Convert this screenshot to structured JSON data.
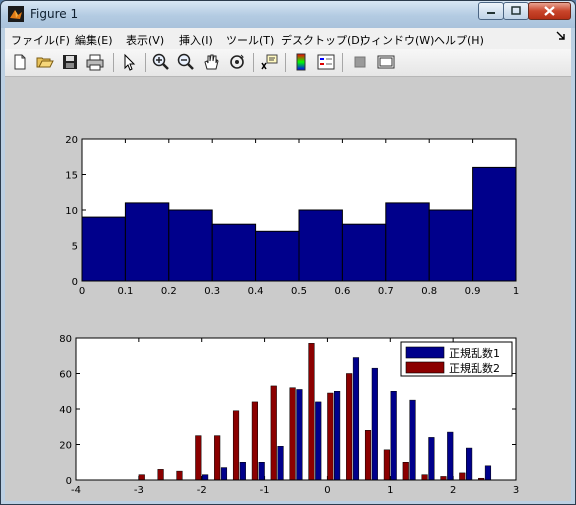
{
  "window": {
    "title": "Figure 1"
  },
  "menu": [
    {
      "label": "ファイル(F)"
    },
    {
      "label": "編集(E)"
    },
    {
      "label": "表示(V)"
    },
    {
      "label": "挿入(I)"
    },
    {
      "label": "ツール(T)"
    },
    {
      "label": "デスクトップ(D)"
    },
    {
      "label": "ウィンドウ(W)"
    },
    {
      "label": "ヘルプ(H)"
    }
  ],
  "toolbar": [
    "new-figure-icon",
    "open-icon",
    "save-icon",
    "print-icon",
    "pointer-icon",
    "zoom-in-icon",
    "zoom-out-icon",
    "pan-hand-icon",
    "rotate-3d-icon",
    "data-cursor-icon",
    "colorbar-icon",
    "legend-icon",
    "hide-plot-tools-icon",
    "show-plot-tools-icon"
  ],
  "chart_data": [
    {
      "type": "bar",
      "x": [
        0.05,
        0.15,
        0.25,
        0.35,
        0.45,
        0.55,
        0.65,
        0.75,
        0.85,
        0.95
      ],
      "values": [
        9,
        11,
        10,
        8,
        7,
        10,
        8,
        11,
        10,
        16
      ],
      "xlim": [
        0,
        1
      ],
      "ylim": [
        0,
        20
      ],
      "xticks": [
        "0",
        "0.1",
        "0.2",
        "0.3",
        "0.4",
        "0.5",
        "0.6",
        "0.7",
        "0.8",
        "0.9",
        "1"
      ],
      "yticks": [
        "0",
        "5",
        "10",
        "15",
        "20"
      ],
      "color": "#00008b"
    },
    {
      "type": "bar",
      "x": [
        -2.9,
        -2.6,
        -2.3,
        -2.0,
        -1.7,
        -1.4,
        -1.1,
        -0.8,
        -0.5,
        -0.2,
        0.1,
        0.4,
        0.7,
        1.0,
        1.3,
        1.6,
        1.9,
        2.2,
        2.5
      ],
      "xlim": [
        -4,
        3
      ],
      "ylim": [
        0,
        80
      ],
      "xticks": [
        "-4",
        "-3",
        "-2",
        "-1",
        "0",
        "1",
        "2",
        "3"
      ],
      "yticks": [
        "0",
        "20",
        "40",
        "60",
        "80"
      ],
      "legend_position": "top-right",
      "series": [
        {
          "name": "正規乱数1",
          "color": "#00008b",
          "values": [
            0,
            0,
            0,
            3,
            7,
            10,
            10,
            19,
            51,
            44,
            50,
            69,
            63,
            50,
            45,
            24,
            27,
            18,
            8
          ]
        },
        {
          "name": "正規乱数2",
          "color": "#8b0000",
          "values": [
            3,
            6,
            5,
            25,
            25,
            39,
            44,
            53,
            52,
            77,
            49,
            60,
            28,
            17,
            10,
            3,
            2,
            4,
            1
          ]
        }
      ]
    }
  ]
}
